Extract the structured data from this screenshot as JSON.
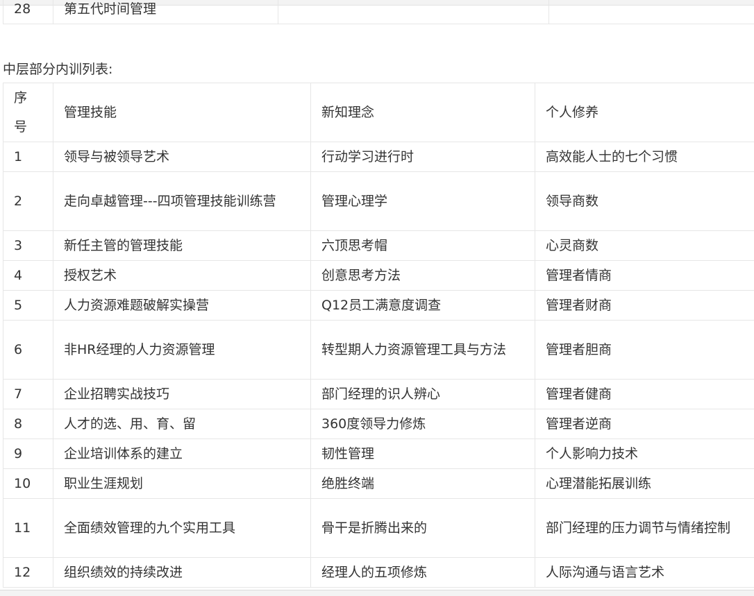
{
  "previous_table": {
    "last_row": {
      "num": "28",
      "course": "第五代时间管理"
    }
  },
  "section_title": "中层部分内训列表:",
  "table": {
    "headers": [
      "序号",
      "管理技能",
      "新知理念",
      "个人修养"
    ],
    "rows": [
      [
        "1",
        "领导与被领导艺术",
        "行动学习进行时",
        "高效能人士的七个习惯"
      ],
      [
        "2",
        "走向卓越管理---四项管理技能训练营",
        "管理心理学",
        "领导商数"
      ],
      [
        "3",
        "新任主管的管理技能",
        "六顶思考帽",
        "心灵商数"
      ],
      [
        "4",
        "授权艺术",
        "创意思考方法",
        "管理者情商"
      ],
      [
        "5",
        "人力资源难题破解实操营",
        "Q12员工满意度调查",
        "管理者财商"
      ],
      [
        "6",
        "非HR经理的人力资源管理",
        "转型期人力资源管理工具与方法",
        "管理者胆商"
      ],
      [
        "7",
        "企业招聘实战技巧",
        "部门经理的识人辨心",
        "管理者健商"
      ],
      [
        "8",
        "人才的选、用、育、留",
        "360度领导力修炼",
        "管理者逆商"
      ],
      [
        "9",
        "企业培训体系的建立",
        "韧性管理",
        "个人影响力技术"
      ],
      [
        "10",
        "职业生涯规划",
        "绝胜终端",
        "心理潜能拓展训练"
      ],
      [
        "11",
        "全面绩效管理的九个实用工具",
        "骨干是折腾出来的",
        "部门经理的压力调节与情绪控制"
      ],
      [
        "12",
        "组织绩效的持续改进",
        "经理人的五项修炼",
        "人际沟通与语言艺术"
      ]
    ]
  }
}
